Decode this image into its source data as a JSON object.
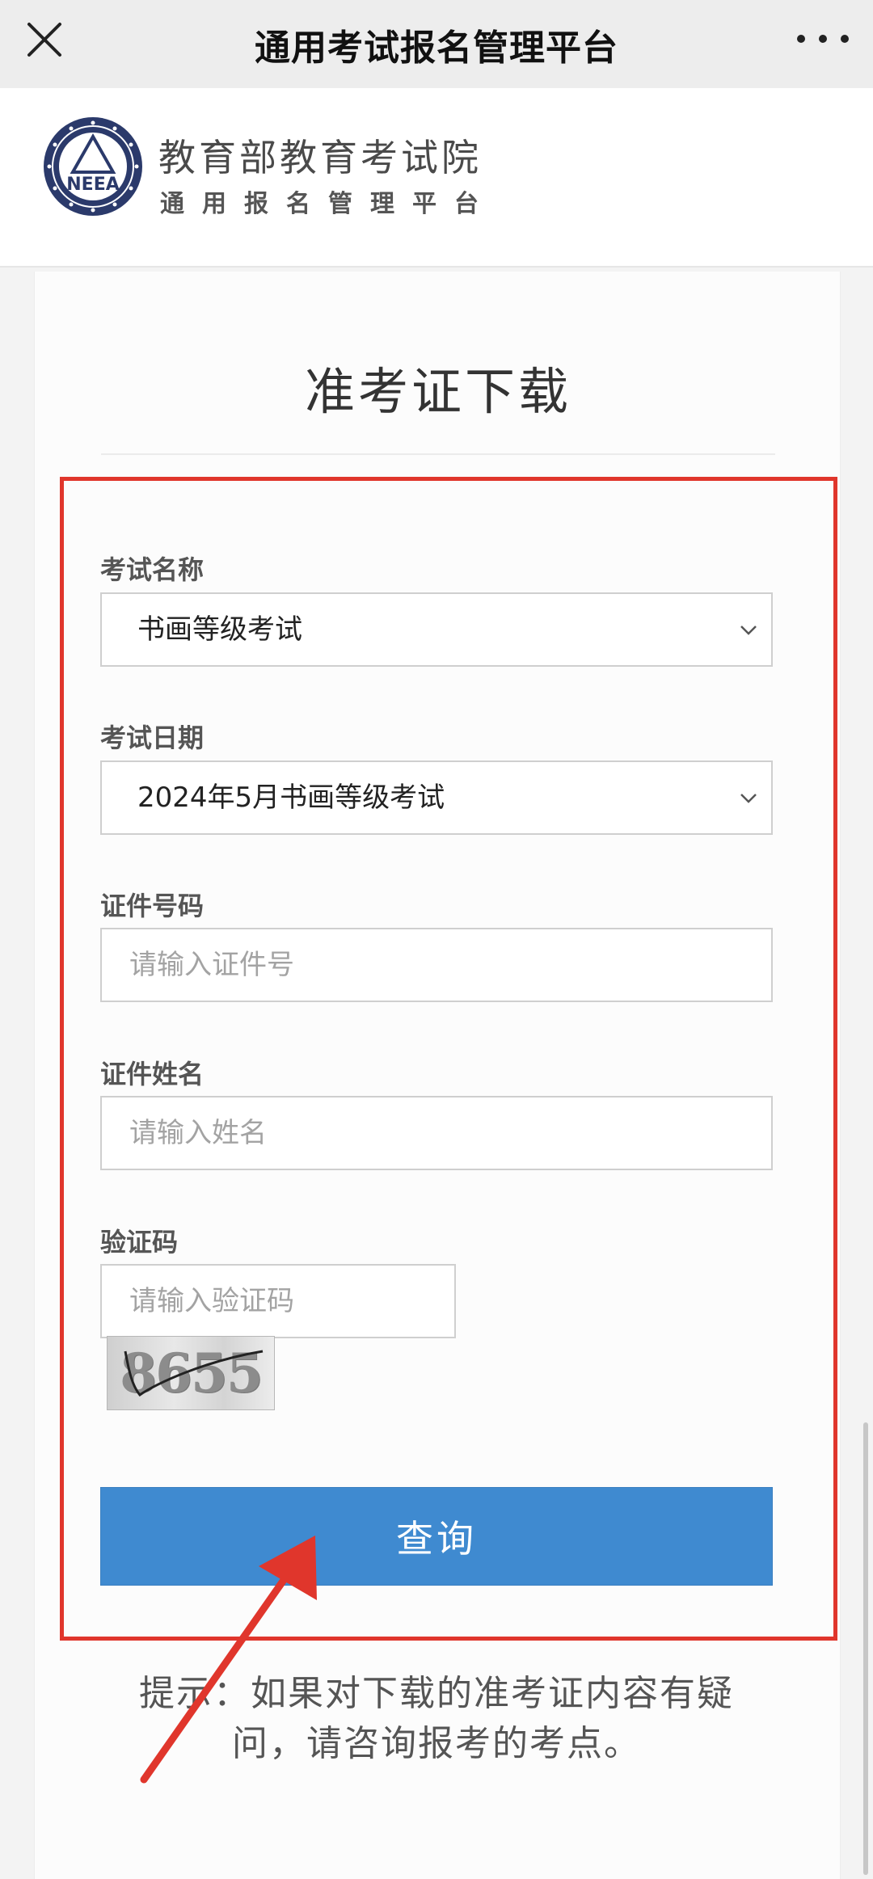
{
  "topbar": {
    "title": "通用考试报名管理平台"
  },
  "header": {
    "org_name": "教育部教育考试院",
    "platform_name": "通用报名管理平台",
    "logo_letters": "NEEA"
  },
  "form": {
    "title": "准考证下载",
    "exam_name": {
      "label": "考试名称",
      "selected": "书画等级考试"
    },
    "exam_date": {
      "label": "考试日期",
      "selected": "2024年5月书画等级考试"
    },
    "id_number": {
      "label": "证件号码",
      "placeholder": "请输入证件号"
    },
    "id_name": {
      "label": "证件姓名",
      "placeholder": "请输入姓名"
    },
    "captcha": {
      "label": "验证码",
      "placeholder": "请输入验证码",
      "image_text": "8655"
    },
    "submit_label": "查询",
    "tip_line1": "提示：如果对下载的准考证内容有疑",
    "tip_line2": "问，请咨询报考的考点。"
  },
  "colors": {
    "primary_button": "#3f8ad0",
    "highlight_frame": "#e0362c",
    "logo_navy": "#2b3a6b"
  },
  "icons": [
    "close-icon",
    "more-icon",
    "chevron-down-icon",
    "arrow-pointer"
  ]
}
